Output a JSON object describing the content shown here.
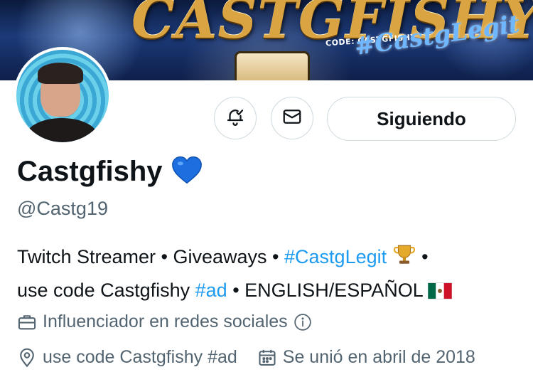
{
  "banner": {
    "title": "CASTGFISHY",
    "code_text": "CODE: CASTGFISHY",
    "hashtag": "#CastgLegit"
  },
  "profile": {
    "display_name": "Castgfishy",
    "handle": "@Castg19",
    "follow_label": "Siguiendo",
    "bio": {
      "line1_text": "Twitch Streamer • Giveaways • ",
      "line1_tag": "#CastgLegit",
      "line1_end": " •",
      "line2_text": "use code Castgfishy ",
      "line2_tag": "#ad",
      "line2_end": " • ENGLISH/ESPAÑOL "
    },
    "category": "Influenciador en redes sociales",
    "location": "use code Castgfishy #ad",
    "joined": "Se unió en abril de 2018"
  },
  "colors": {
    "accent": "#1d9bf0",
    "text": "#0f1419",
    "muted": "#536471",
    "border": "#cfd9de",
    "heart": "#1d6fe0"
  },
  "icons": [
    "bell-check-icon",
    "mail-icon",
    "blue-heart-icon",
    "trophy-icon",
    "mexico-flag-icon",
    "briefcase-icon",
    "info-icon",
    "location-icon",
    "calendar-icon"
  ]
}
